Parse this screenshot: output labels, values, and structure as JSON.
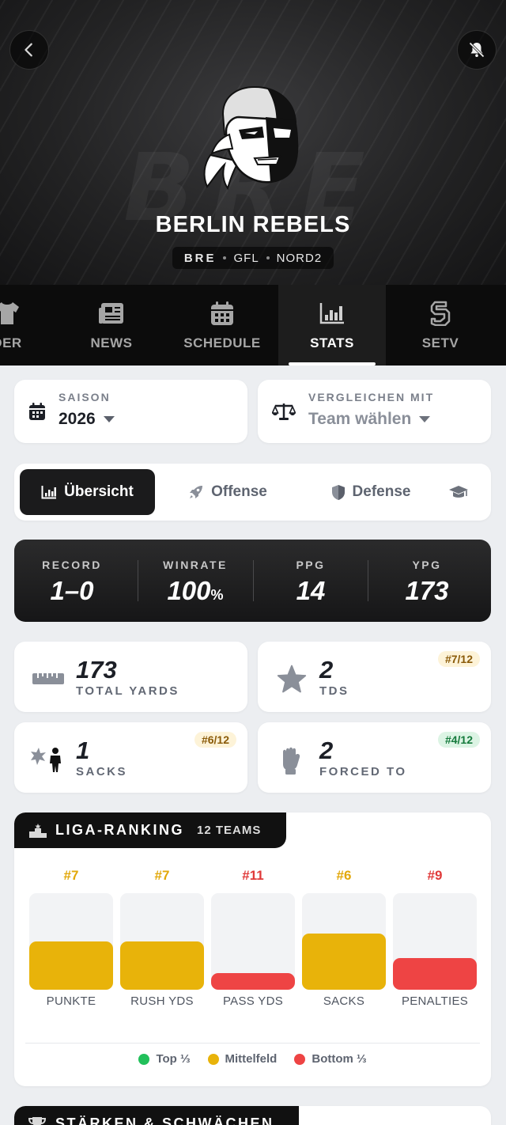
{
  "team": {
    "watermark": "BRE",
    "name": "BERLIN REBELS",
    "abbr": "BRE",
    "league": "GFL",
    "division": "NORD2"
  },
  "tabs": [
    {
      "label": "DER",
      "icon": "shirt-icon",
      "active": false
    },
    {
      "label": "NEWS",
      "icon": "newspaper-icon",
      "active": false
    },
    {
      "label": "SCHEDULE",
      "icon": "calendar-icon",
      "active": false
    },
    {
      "label": "STATS",
      "icon": "bar-chart-icon",
      "active": true
    },
    {
      "label": "SETV",
      "icon": "setv-logo-icon",
      "active": false
    }
  ],
  "season": {
    "label": "SAISON",
    "value": "2026"
  },
  "compare": {
    "label": "VERGLEICHEN MIT",
    "value": "Team wählen"
  },
  "segments": [
    {
      "label": "Übersicht",
      "icon": "bar-chart-icon",
      "active": true
    },
    {
      "label": "Offense",
      "icon": "rocket-icon",
      "active": false
    },
    {
      "label": "Defense",
      "icon": "shield-icon",
      "active": false
    },
    {
      "label": "",
      "icon": "graduation-cap-icon",
      "active": false
    }
  ],
  "summary": [
    {
      "label": "RECORD",
      "value": "1–0",
      "unit": ""
    },
    {
      "label": "WINRATE",
      "value": "100",
      "unit": "%"
    },
    {
      "label": "PPG",
      "value": "14",
      "unit": ""
    },
    {
      "label": "YPG",
      "value": "173",
      "unit": ""
    }
  ],
  "stats": [
    {
      "value": "173",
      "label": "TOTAL YARDS",
      "badge": "",
      "icon": "ruler-icon"
    },
    {
      "value": "2",
      "label": "TDS",
      "badge": "#7/12",
      "badge_color": "yellow",
      "icon": "star-icon"
    },
    {
      "value": "1",
      "label": "SACKS",
      "badge": "#6/12",
      "badge_color": "yellow",
      "icon": "sack-icon"
    },
    {
      "value": "2",
      "label": "FORCED TO",
      "badge": "#4/12",
      "badge_color": "green",
      "icon": "fist-icon"
    }
  ],
  "ranking": {
    "title": "LIGA-RANKING",
    "count": "12 TEAMS",
    "bars": [
      {
        "rank": "#7",
        "label": "PUNKTE",
        "level": 0.5,
        "tier": "mid"
      },
      {
        "rank": "#7",
        "label": "RUSH YDS",
        "level": 0.5,
        "tier": "mid"
      },
      {
        "rank": "#11",
        "label": "PASS YDS",
        "level": 0.17,
        "tier": "bottom"
      },
      {
        "rank": "#6",
        "label": "SACKS",
        "level": 0.58,
        "tier": "mid"
      },
      {
        "rank": "#9",
        "label": "PENALTIES",
        "level": 0.33,
        "tier": "bottom"
      }
    ],
    "legend": [
      {
        "label": "Top ⅓",
        "color": "#22c05b"
      },
      {
        "label": "Mittelfeld",
        "color": "#e8b30a"
      },
      {
        "label": "Bottom ⅓",
        "color": "#ee4444"
      }
    ],
    "colors": {
      "mid": "#e8b30a",
      "bottom": "#ee4444",
      "mid_text": "#e2a80a",
      "bottom_text": "#e03a3a"
    }
  },
  "next_section": {
    "title": "STÄRKEN & SCHWÄCHEN",
    "icon": "trophy-icon"
  }
}
